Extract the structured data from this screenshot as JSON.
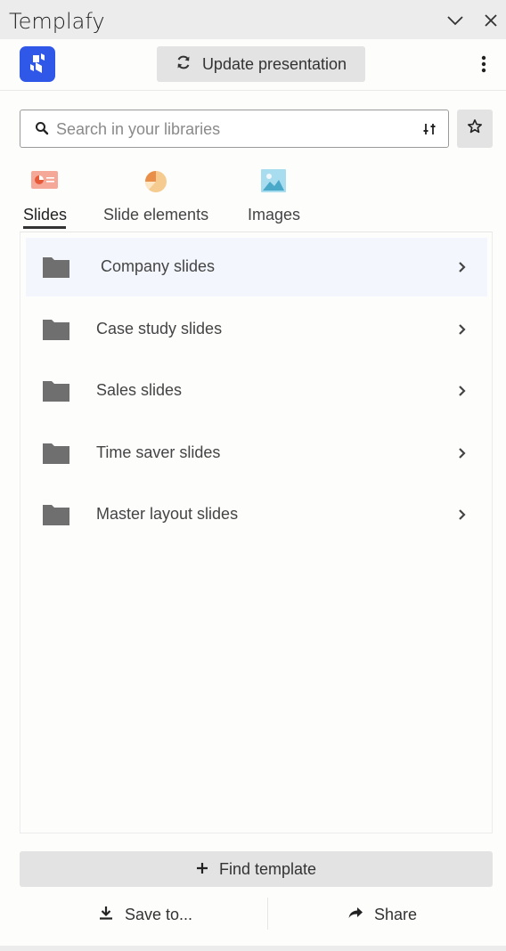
{
  "window": {
    "title": "Templafy"
  },
  "header": {
    "update_label": "Update presentation"
  },
  "search": {
    "placeholder": "Search in your libraries",
    "value": ""
  },
  "tabs": [
    {
      "label": "Slides",
      "icon": "presentation-slide-icon",
      "active": true
    },
    {
      "label": "Slide elements",
      "icon": "pie-chart-icon",
      "active": false
    },
    {
      "label": "Images",
      "icon": "image-icon",
      "active": false
    }
  ],
  "folders": [
    {
      "label": "Company slides",
      "icon": "folder-icon"
    },
    {
      "label": "Case study slides",
      "icon": "folder-icon"
    },
    {
      "label": "Sales slides",
      "icon": "folder-icon"
    },
    {
      "label": "Time saver slides",
      "icon": "folder-icon"
    },
    {
      "label": "Master layout slides",
      "icon": "folder-icon"
    }
  ],
  "actions": {
    "find_template": "Find template",
    "save_to": "Save to...",
    "share": "Share"
  },
  "colors": {
    "brand": "#2f57e8",
    "row_hover": "#f3f7fd",
    "button_bg": "#e3e3e3"
  }
}
